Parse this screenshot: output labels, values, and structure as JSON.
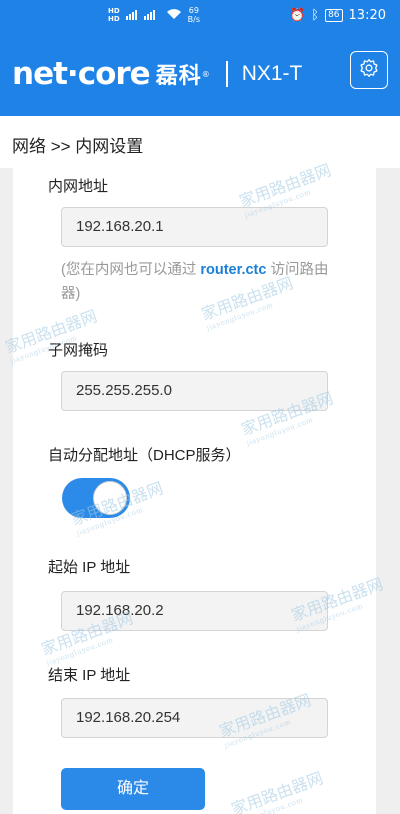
{
  "status_bar": {
    "hd1": "HD",
    "hd2": "HD",
    "net_speed": "69",
    "net_unit": "B/s",
    "battery": "86",
    "time": "13:20"
  },
  "header": {
    "logo_en": "net·core",
    "logo_cn": "磊科",
    "logo_reg": "®",
    "model": "NX1-T"
  },
  "breadcrumb": "网络 >> 内网设置",
  "form": {
    "lan_ip_label": "内网地址",
    "lan_ip_value": "192.168.20.1",
    "hint_before": "(您在内网也可以通过 ",
    "hint_link": "router.ctc",
    "hint_after": " 访问路由器)",
    "subnet_label": "子网掩码",
    "subnet_value": "255.255.255.0",
    "dhcp_label": "自动分配地址（DHCP服务）",
    "dhcp_enabled": true,
    "start_ip_label": "起始 IP 地址",
    "start_ip_value": "192.168.20.2",
    "end_ip_label": "结束 IP 地址",
    "end_ip_value": "192.168.20.254",
    "confirm_label": "确定"
  },
  "watermark": {
    "text": "家用路由器网",
    "sub": "jiayongluyou.com"
  },
  "colors": {
    "brand_blue": "#1e82e6",
    "button_blue": "#2b8ae8",
    "link_blue": "#1a7fd8"
  }
}
